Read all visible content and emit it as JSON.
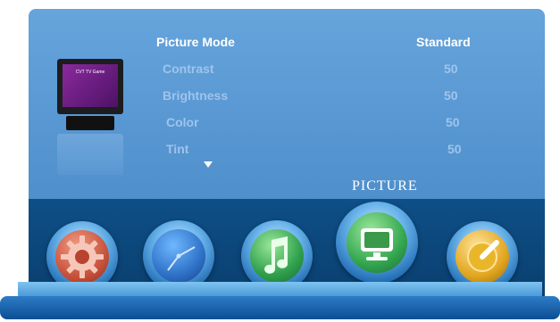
{
  "menu": {
    "rows": [
      {
        "label": "Picture Mode",
        "value": "Standard"
      },
      {
        "label": "Contrast",
        "value": "50"
      },
      {
        "label": "Brightness",
        "value": "50"
      },
      {
        "label": "Color",
        "value": "50"
      },
      {
        "label": "Tint",
        "value": "50"
      }
    ],
    "thumbnail_text": "CVT TV Game"
  },
  "dock": {
    "active_label": "PICTURE",
    "icons": [
      {
        "name": "settings-gear-icon"
      },
      {
        "name": "clock-icon"
      },
      {
        "name": "music-note-icon"
      },
      {
        "name": "picture-monitor-icon"
      },
      {
        "name": "dial-knob-icon"
      }
    ]
  }
}
